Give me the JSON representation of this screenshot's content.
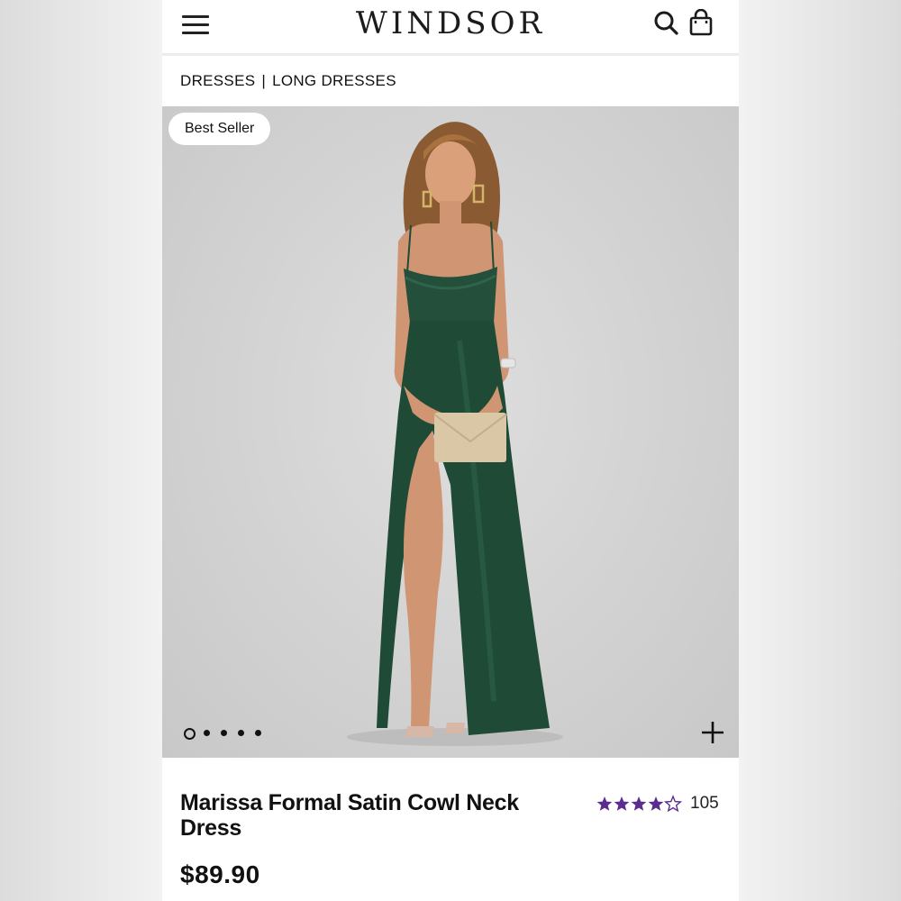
{
  "header": {
    "logo": "WINDSOR",
    "icons": [
      "menu-icon",
      "search-icon",
      "bag-icon"
    ]
  },
  "breadcrumb": {
    "items": [
      "DRESSES",
      "LONG DRESSES"
    ],
    "separator": "|"
  },
  "gallery": {
    "badge": "Best Seller",
    "image_count": 5,
    "active_index": 0,
    "colors": {
      "dress": "#1f4a36",
      "background": "#d2d2d2"
    }
  },
  "product": {
    "name": "Marissa Formal Satin Cowl Neck Dress",
    "price": "$89.90",
    "rating_value": 4.5,
    "rating_count": "105",
    "star_color": "#5b2d91"
  }
}
